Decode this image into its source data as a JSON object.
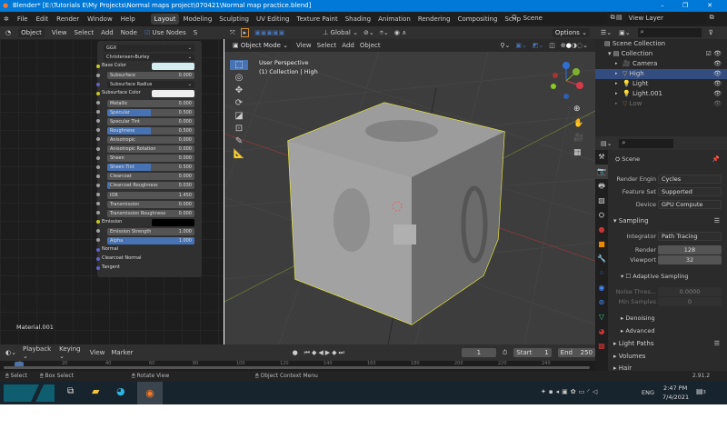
{
  "window": {
    "title": "Blender* [E:\\Tutorials E\\My Projects\\Normal maps project\\070421\\Normal map practice.blend]",
    "minimize": "–",
    "maximize": "❐",
    "close": "✕"
  },
  "menu": {
    "items": [
      "File",
      "Edit",
      "Render",
      "Window",
      "Help"
    ],
    "workspaces": [
      "Layout",
      "Modeling",
      "Sculpting",
      "UV Editing",
      "Texture Paint",
      "Shading",
      "Animation",
      "Rendering",
      "Compositing",
      "Scripting"
    ],
    "add_tab": "+",
    "scene": "Scene",
    "view_layer": "View Layer"
  },
  "node_header": {
    "object": "Object",
    "items": [
      "View",
      "Select",
      "Add",
      "Node"
    ],
    "use_nodes": "Use Nodes",
    "slot": "S"
  },
  "node": {
    "distribution": "GGX",
    "subsurface_method": "Christensen-Burley",
    "rows": [
      {
        "label": "Base Color",
        "type": "color",
        "color": "#d4eef0",
        "socket": "#c7c729"
      },
      {
        "label": "Subsurface",
        "value": "0.000",
        "fill": 0
      },
      {
        "label": "Subsurface Radius",
        "type": "dropdown",
        "socket": "#6363c7"
      },
      {
        "label": "Subsurface Color",
        "type": "color",
        "color": "#eeeeee",
        "socket": "#c7c729"
      },
      {
        "label": "Metallic",
        "value": "0.000",
        "fill": 0
      },
      {
        "label": "Specular",
        "value": "0.500",
        "fill": 0.5
      },
      {
        "label": "Specular Tint",
        "value": "0.000",
        "fill": 0
      },
      {
        "label": "Roughness",
        "value": "0.500",
        "fill": 0.5
      },
      {
        "label": "Anisotropic",
        "value": "0.000",
        "fill": 0
      },
      {
        "label": "Anisotropic Rotation",
        "value": "0.000",
        "fill": 0
      },
      {
        "label": "Sheen",
        "value": "0.000",
        "fill": 0
      },
      {
        "label": "Sheen Tint",
        "value": "0.500",
        "fill": 0.5
      },
      {
        "label": "Clearcoat",
        "value": "0.000",
        "fill": 0
      },
      {
        "label": "Clearcoat Roughness",
        "value": "0.030",
        "fill": 0.03
      },
      {
        "label": "IOR",
        "value": "1.450",
        "fill": 0
      },
      {
        "label": "Transmission",
        "value": "0.000",
        "fill": 0
      },
      {
        "label": "Transmission Roughness",
        "value": "0.000",
        "fill": 0
      },
      {
        "label": "Emission",
        "type": "color",
        "color": "#000000",
        "socket": "#c7c729"
      },
      {
        "label": "Emission Strength",
        "value": "1.000",
        "fill": 0
      },
      {
        "label": "Alpha",
        "value": "1.000",
        "fill": 1
      },
      {
        "label": "Normal",
        "type": "socket",
        "socket": "#6363c7"
      },
      {
        "label": "Clearcoat Normal",
        "type": "socket",
        "socket": "#6363c7"
      },
      {
        "label": "Tangent",
        "type": "socket",
        "socket": "#6363c7"
      }
    ]
  },
  "material_name": "Material.001",
  "viewport": {
    "mode": "Object Mode",
    "items": [
      "View",
      "Select",
      "Add",
      "Object"
    ],
    "transform": "Global",
    "options": "Options",
    "perspective": "User Perspective",
    "collection": "(1) Collection | High",
    "axes": [
      "X",
      "Y",
      "Z"
    ]
  },
  "outliner": {
    "scene_collection": "Scene Collection",
    "collection": "Collection",
    "items": [
      {
        "name": "Camera",
        "selected": false
      },
      {
        "name": "High",
        "selected": true
      },
      {
        "name": "Light",
        "selected": false
      },
      {
        "name": "Light.001",
        "selected": false
      },
      {
        "name": "Low",
        "selected": false,
        "hidden": true
      }
    ]
  },
  "properties": {
    "scene": "Scene",
    "render_engine_label": "Render Engin",
    "render_engine": "Cycles",
    "feature_set_label": "Feature Set",
    "feature_set": "Supported",
    "device_label": "Device",
    "device": "GPU Compute",
    "sampling": "Sampling",
    "integrator_label": "Integrator",
    "integrator": "Path Tracing",
    "render_label": "Render",
    "render_samples": "128",
    "viewport_label": "Viewport",
    "viewport_samples": "32",
    "adaptive": "Adaptive Sampling",
    "noise_label": "Noise Thres...",
    "noise_value": "0.0000",
    "min_samples_label": "Min Samples",
    "min_samples": "0",
    "denoising": "Denoising",
    "advanced": "Advanced",
    "light_paths": "Light Paths",
    "volumes": "Volumes",
    "hair": "Hair"
  },
  "timeline": {
    "items": [
      "Playback",
      "Keying",
      "View",
      "Marker"
    ],
    "current_frame": "1",
    "start_label": "Start",
    "start": "1",
    "end_label": "End",
    "end": "250",
    "ticks": [
      "0",
      "20",
      "40",
      "60",
      "80",
      "100",
      "120",
      "140",
      "160",
      "180",
      "200",
      "220",
      "240"
    ]
  },
  "status": {
    "select": "Select",
    "box_select": "Box Select",
    "rotate": "Rotate View",
    "context": "Object Context Menu",
    "version": "2.91.2"
  },
  "taskbar": {
    "lang": "ENG",
    "time": "2:47 PM",
    "date": "7/4/2021",
    "notifications": "3"
  }
}
